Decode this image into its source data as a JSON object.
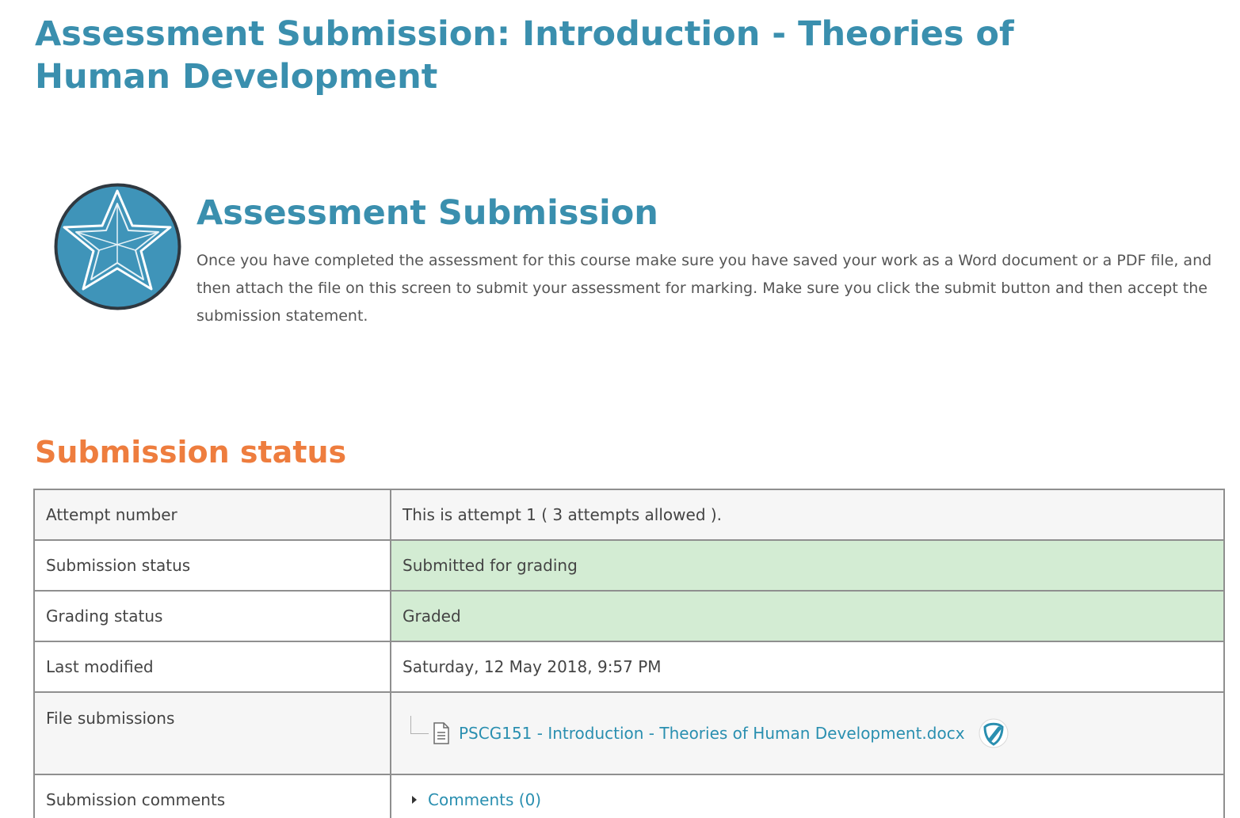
{
  "page": {
    "title": "Assessment Submission: Introduction - Theories of Human Development"
  },
  "intro": {
    "icon": "star-badge-icon",
    "heading": "Assessment Submission",
    "text": "Once you have completed the assessment for this course make sure you have saved your work as a Word document or a PDF file, and then attach the file on this screen to submit your assessment for marking. Make sure you click the submit button and then accept the submission statement."
  },
  "status": {
    "heading": "Submission status",
    "rows": [
      {
        "label": "Attempt number",
        "value": "This is attempt 1 ( 3 attempts allowed )."
      },
      {
        "label": "Submission status",
        "value": "Submitted for grading"
      },
      {
        "label": "Grading status",
        "value": "Graded"
      },
      {
        "label": "Last modified",
        "value": "Saturday, 12 May 2018, 9:57 PM"
      },
      {
        "label": "File submissions",
        "value": "PSCG151 - Introduction - Theories of Human Development.docx"
      },
      {
        "label": "Submission comments",
        "value": "Comments (0)"
      }
    ]
  },
  "colors": {
    "title": "#3a8fae",
    "status_heading": "#ee7d3e",
    "success_bg": "#d3ecd3",
    "link": "#2a8fb0"
  },
  "icons": {
    "file": "document-icon",
    "plagiarism": "turnitin-icon",
    "comments_toggle": "caret-right-icon"
  }
}
